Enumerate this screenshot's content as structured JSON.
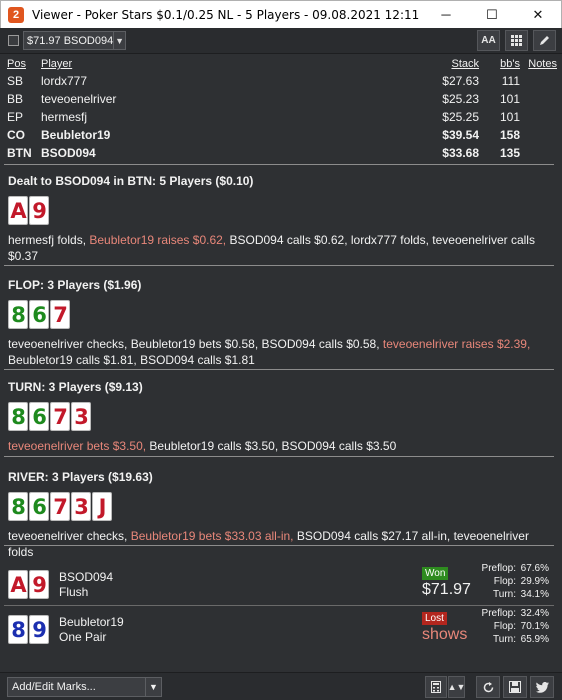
{
  "window": {
    "title": "Viewer - Poker Stars $0.1/0.25 NL - 5 Players - 09.08.2021 12:11",
    "app_icon": "2",
    "minimize_icon": "─",
    "maximize_icon": "☐",
    "close_icon": "✕"
  },
  "toolbar": {
    "hand_select_value": "$71.97 BSOD094",
    "font_button": "AA"
  },
  "players": {
    "headers": {
      "pos": "Pos",
      "player": "Player",
      "stack": "Stack",
      "bbs": "bb's",
      "notes": "Notes"
    },
    "rows": [
      {
        "pos": "SB",
        "player": "lordx777",
        "stack": "$27.63",
        "bbs": "111",
        "bold": false
      },
      {
        "pos": "BB",
        "player": "teveoenelriver",
        "stack": "$25.23",
        "bbs": "101",
        "bold": false
      },
      {
        "pos": "EP",
        "player": "hermesfj",
        "stack": "$25.25",
        "bbs": "101",
        "bold": false
      },
      {
        "pos": "CO",
        "player": "Beubletor19",
        "stack": "$39.54",
        "bbs": "158",
        "bold": true
      },
      {
        "pos": "BTN",
        "player": "BSOD094",
        "stack": "$33.68",
        "bbs": "135",
        "bold": true
      }
    ]
  },
  "streets": [
    {
      "title": "Dealt to BSOD094 in BTN: 5 Players ($0.10)",
      "cards": [
        {
          "rank": "A",
          "color": "red"
        },
        {
          "rank": "9",
          "color": "red"
        }
      ],
      "actions": [
        {
          "text": "hermesfj folds, ",
          "hl": false
        },
        {
          "text": "Beubletor19 raises $0.62,",
          "hl": true
        },
        {
          "text": " BSOD094 calls $0.62, lordx777 folds, teveoenelriver calls $0.37",
          "hl": false
        }
      ]
    },
    {
      "title": "FLOP: 3 Players ($1.96)",
      "cards": [
        {
          "rank": "8",
          "color": "green"
        },
        {
          "rank": "6",
          "color": "green"
        },
        {
          "rank": "7",
          "color": "red"
        }
      ],
      "actions": [
        {
          "text": "teveoenelriver checks, Beubletor19 bets $0.58, BSOD094 calls $0.58, ",
          "hl": false
        },
        {
          "text": "teveoenelriver raises $2.39,",
          "hl": true
        },
        {
          "text": " Beubletor19 calls $1.81, BSOD094 calls $1.81",
          "hl": false
        }
      ]
    },
    {
      "title": "TURN: 3 Players ($9.13)",
      "cards": [
        {
          "rank": "8",
          "color": "green"
        },
        {
          "rank": "6",
          "color": "green"
        },
        {
          "rank": "7",
          "color": "red"
        },
        {
          "rank": "3",
          "color": "red"
        }
      ],
      "actions": [
        {
          "text": "teveoenelriver bets $3.50,",
          "hl": true
        },
        {
          "text": " Beubletor19 calls $3.50, BSOD094 calls $3.50",
          "hl": false
        }
      ]
    },
    {
      "title": "RIVER: 3 Players ($19.63)",
      "cards": [
        {
          "rank": "8",
          "color": "green"
        },
        {
          "rank": "6",
          "color": "green"
        },
        {
          "rank": "7",
          "color": "red"
        },
        {
          "rank": "3",
          "color": "red"
        },
        {
          "rank": "J",
          "color": "red"
        }
      ],
      "actions": [
        {
          "text": "teveoenelriver checks, ",
          "hl": false
        },
        {
          "text": "Beubletor19 bets $33.03 all-in,",
          "hl": true
        },
        {
          "text": " BSOD094 calls $27.17 all-in, teveoenelriver folds",
          "hl": false
        }
      ]
    }
  ],
  "results": [
    {
      "name": "BSOD094",
      "hand": "Flush",
      "cards": [
        {
          "rank": "A",
          "color": "red"
        },
        {
          "rank": "9",
          "color": "red"
        }
      ],
      "badge": "Won",
      "badge_type": "won",
      "amount": "$71.97",
      "amount_color": "white",
      "equity": [
        {
          "label": "Preflop:",
          "value": "67.6%"
        },
        {
          "label": "Flop:",
          "value": "29.9%"
        },
        {
          "label": "Turn:",
          "value": "34.1%"
        }
      ]
    },
    {
      "name": "Beubletor19",
      "hand": "One Pair",
      "cards": [
        {
          "rank": "8",
          "color": "blue"
        },
        {
          "rank": "9",
          "color": "blue"
        }
      ],
      "badge": "Lost",
      "badge_type": "lost",
      "amount": "shows",
      "amount_color": "red",
      "equity": [
        {
          "label": "Preflop:",
          "value": "32.4%"
        },
        {
          "label": "Flop:",
          "value": "70.1%"
        },
        {
          "label": "Turn:",
          "value": "65.9%"
        }
      ]
    }
  ],
  "bottombar": {
    "marks_placeholder": "Add/Edit Marks..."
  },
  "colors": {
    "background": "#2e3033",
    "highlight": "#e8877a",
    "won": "#2e8b1f",
    "lost": "#b3261e",
    "card_red": "#c2192a",
    "card_green": "#1e8a1e",
    "card_blue": "#1c2fb0"
  }
}
